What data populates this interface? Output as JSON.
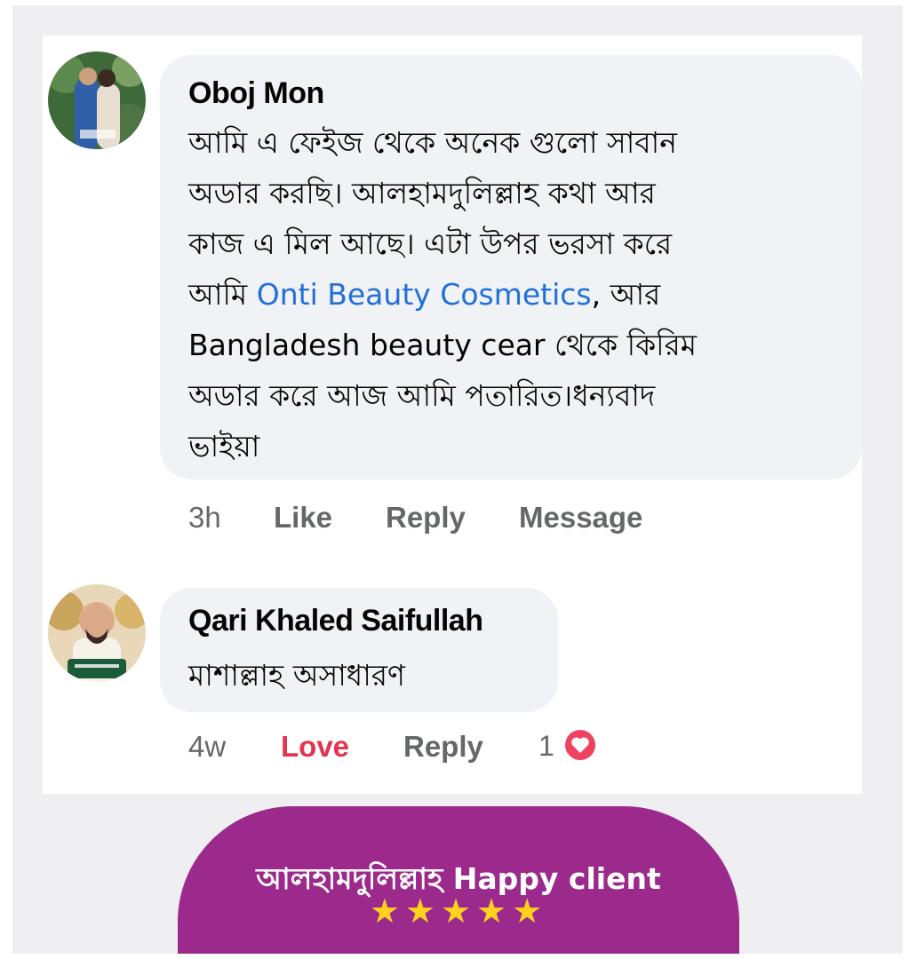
{
  "comments": [
    {
      "author": "Oboj Mon",
      "lines": [
        "আমি এ ফেইজ থেকে অনেক গুলো সাবান",
        "অডার করছি। আলহামদুলিল্লাহ কথা আর",
        "কাজ এ মিল আছে। এটা উপর ভরসা করে",
        "",
        "Bangladesh beauty cear থেকে কিরিম",
        "অডার করে আজ আমি পতারিত।ধন্যবাদ",
        "ভাইয়া"
      ],
      "line4_prefix": "আমি ",
      "line4_link": "Onti Beauty Cosmetics",
      "line4_suffix": ", আর",
      "time": "3h",
      "like_label": "Like",
      "reply_label": "Reply",
      "message_label": "Message"
    },
    {
      "author": "Qari Khaled Saifullah",
      "text": "মাশাল্লাহ অসাধারণ",
      "time": "4w",
      "love_label": "Love",
      "reply_label": "Reply",
      "reaction_count": "1",
      "reaction_icon": "heart-icon"
    }
  ],
  "banner": {
    "title": "আলহামদুলিল্লাহ Happy client",
    "stars": "★★★★★"
  },
  "colors": {
    "link": "#216fdb",
    "love": "#e4344e",
    "banner": "#9b2a8c",
    "stars": "#ffd21f"
  }
}
